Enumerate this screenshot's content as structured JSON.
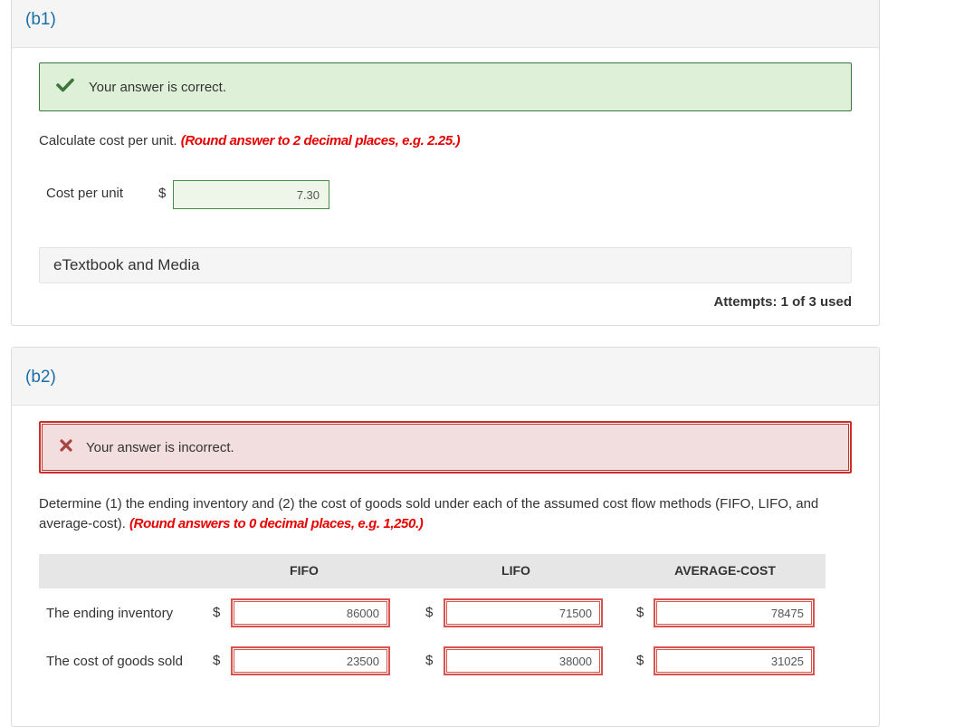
{
  "b1": {
    "label": "(b1)",
    "alert_text": "Your answer is correct.",
    "instruction": "Calculate cost per unit.",
    "instruction_note": "(Round answer to 2 decimal places, e.g. 2.25.)",
    "field_label": "Cost per unit",
    "currency": "$",
    "value": "7.30",
    "etext_label": "eTextbook and Media",
    "attempts": "Attempts: 1 of 3 used",
    "alert_icon": "check-icon"
  },
  "b2": {
    "label": "(b2)",
    "alert_text": "Your answer is incorrect.",
    "alert_icon": "x-icon",
    "instruction_line1": "Determine (1) the ending inventory and (2) the cost of goods sold under each of the assumed cost flow methods (FIFO, LIFO, and",
    "instruction_line2": "average-cost).",
    "instruction_note": "(Round answers to 0 decimal places, e.g. 1,250.)",
    "columns": [
      "FIFO",
      "LIFO",
      "AVERAGE-COST"
    ],
    "currency": "$",
    "rows": [
      {
        "label": "The ending inventory",
        "values": [
          "86000",
          "71500",
          "78475"
        ]
      },
      {
        "label": "The cost of goods sold",
        "values": [
          "23500",
          "38000",
          "31025"
        ]
      }
    ]
  },
  "colors": {
    "part_label": "#1a6fa8",
    "correct_bg": "#dff0d8",
    "correct_border": "#3c763d",
    "incorrect_bg": "#f2dede",
    "incorrect_border": "#c9302c",
    "note_red": "#e60000"
  }
}
